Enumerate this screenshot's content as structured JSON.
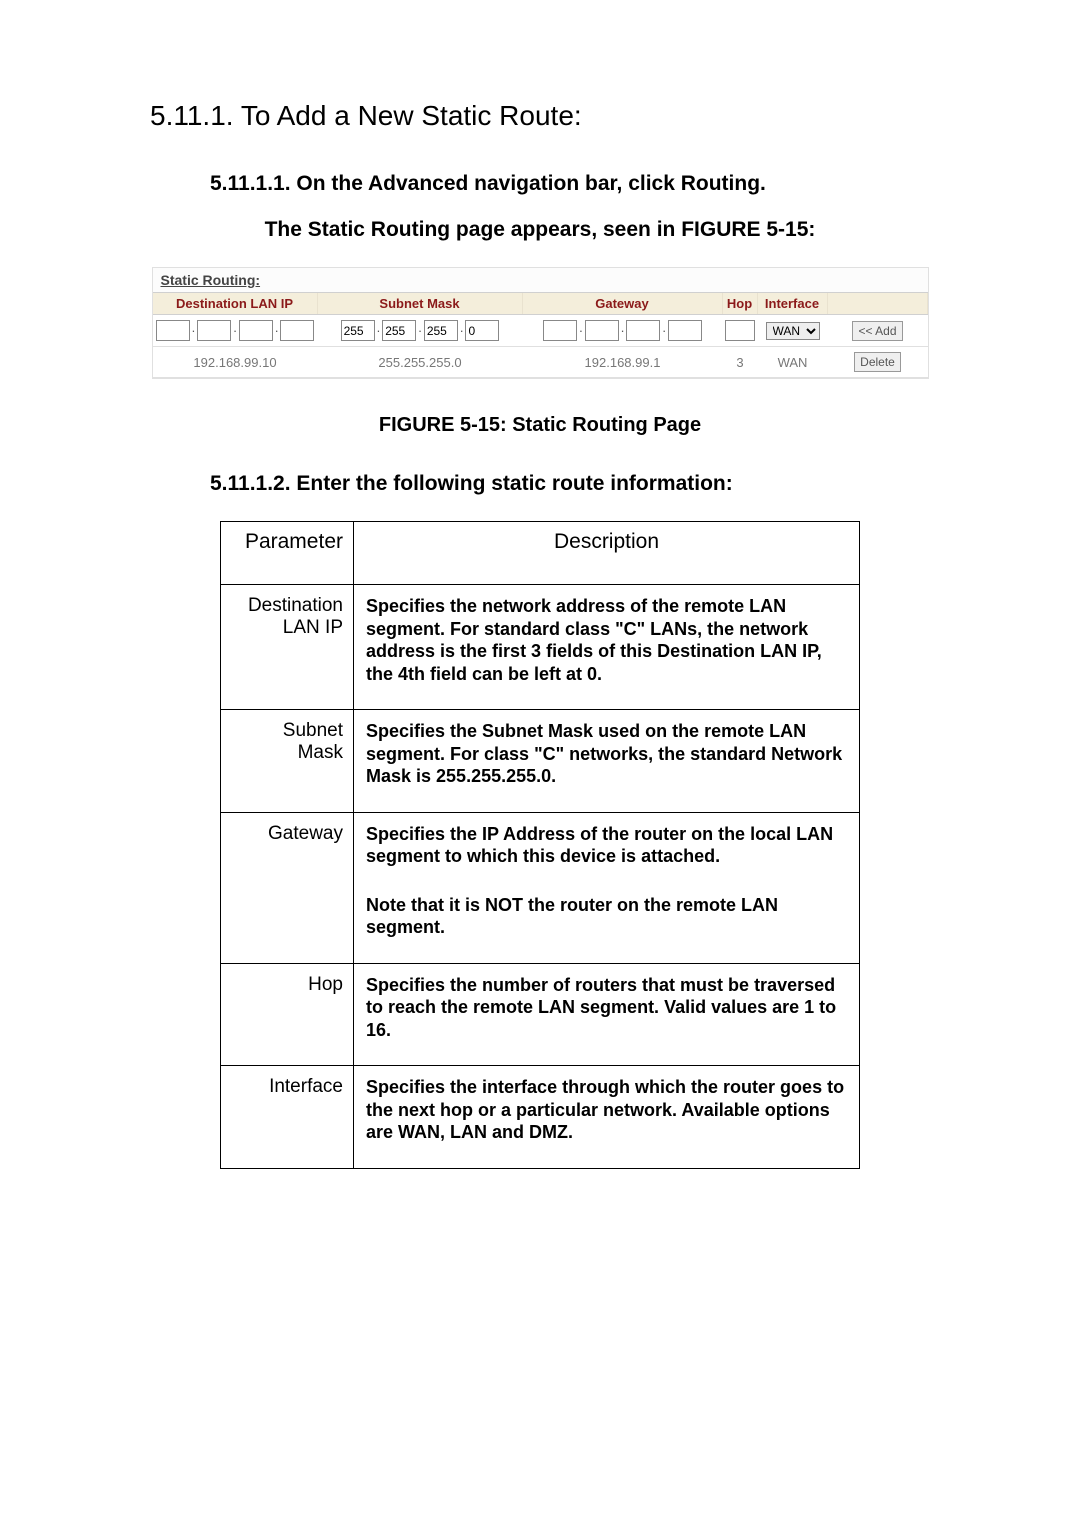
{
  "headings": {
    "h1": "5.11.1. To Add a New Static Route:",
    "h2_1": "5.11.1.1. On the Advanced navigation bar, click Routing.",
    "h3_1": "The Static Routing page appears, seen in FIGURE 5-15:",
    "fig_caption": "FIGURE 5-15: Static Routing Page",
    "h2_2": "5.11.1.2. Enter the following static route information:"
  },
  "routing_fig": {
    "title": "Static Routing:",
    "cols": {
      "dest": "Destination LAN IP",
      "mask": "Subnet Mask",
      "gw": "Gateway",
      "hop": "Hop",
      "if": "Interface"
    },
    "input_row": {
      "mask": [
        "255",
        "255",
        "255",
        "0"
      ],
      "if_selected": "WAN",
      "add_btn": "<< Add"
    },
    "data_row": {
      "dest": "192.168.99.10",
      "mask": "255.255.255.0",
      "gw": "192.168.99.1",
      "hop": "3",
      "iface": "WAN",
      "del_btn": "Delete"
    }
  },
  "param_table": {
    "head_param": "Parameter",
    "head_desc": "Description",
    "rows": [
      {
        "name": "Destination LAN IP",
        "desc": "Specifies the network address of the remote LAN segment. For standard class \"C\" LANs, the network address is the first 3 fields of this Destination LAN IP, the 4th field can be left at 0."
      },
      {
        "name": "Subnet Mask",
        "desc": "Specifies the Subnet Mask used on the remote LAN segment. For class \"C\" networks, the standard Network Mask is 255.255.255.0."
      },
      {
        "name": "Gateway",
        "desc": "Specifies the IP Address of the router on the local LAN segment to which this device is attached.",
        "note": "Note that it is NOT the router on the remote LAN segment."
      },
      {
        "name": "Hop",
        "desc": "Specifies the number of routers that must be traversed to reach the remote LAN segment. Valid values are 1 to 16."
      },
      {
        "name": "Interface",
        "desc": "Specifies the interface through which the router goes to the next hop or a particular network. Available options are WAN, LAN and DMZ."
      }
    ]
  }
}
